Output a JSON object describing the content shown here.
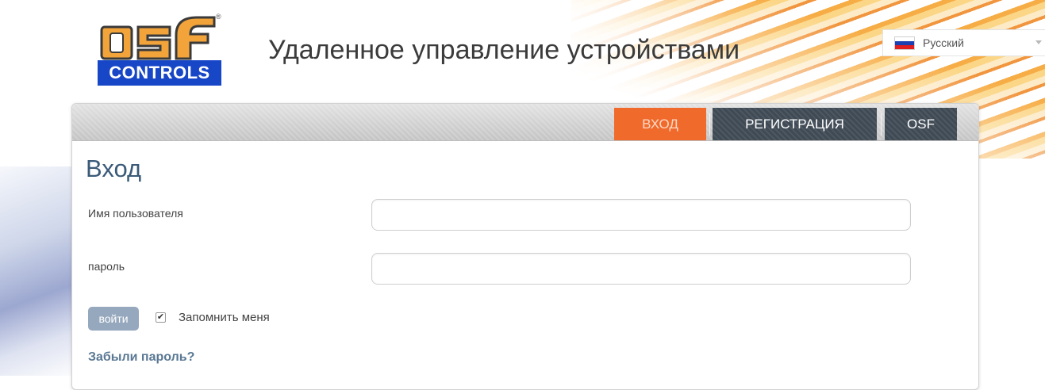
{
  "logo": {
    "letters": "osf",
    "subtitle": "CONTROLS",
    "registered": "®"
  },
  "header": {
    "title": "Удаленное управление устройствами"
  },
  "language": {
    "selected": "Русский",
    "flag_colors": [
      "#ffffff",
      "#1c3fb2",
      "#e11d1d"
    ]
  },
  "nav": {
    "tabs": [
      {
        "label": "ВХОД",
        "active": true
      },
      {
        "label": "РЕГИСТРАЦИЯ",
        "active": false
      },
      {
        "label": "OSF",
        "active": false
      }
    ]
  },
  "login_form": {
    "title": "Вход",
    "username_label": "Имя пользователя",
    "username_value": "",
    "password_label": "пароль",
    "password_value": "",
    "submit_label": "войти",
    "remember_checked": true,
    "remember_label": "Запомнить меня",
    "forgot_link": "Забыли пароль?"
  },
  "colors": {
    "accent_orange": "#f06a2c",
    "nav_dark": "#3f4a55",
    "brand_blue": "#1746c7",
    "button_blue_gray": "#96a8bd",
    "title_blue": "#3a5a78"
  }
}
